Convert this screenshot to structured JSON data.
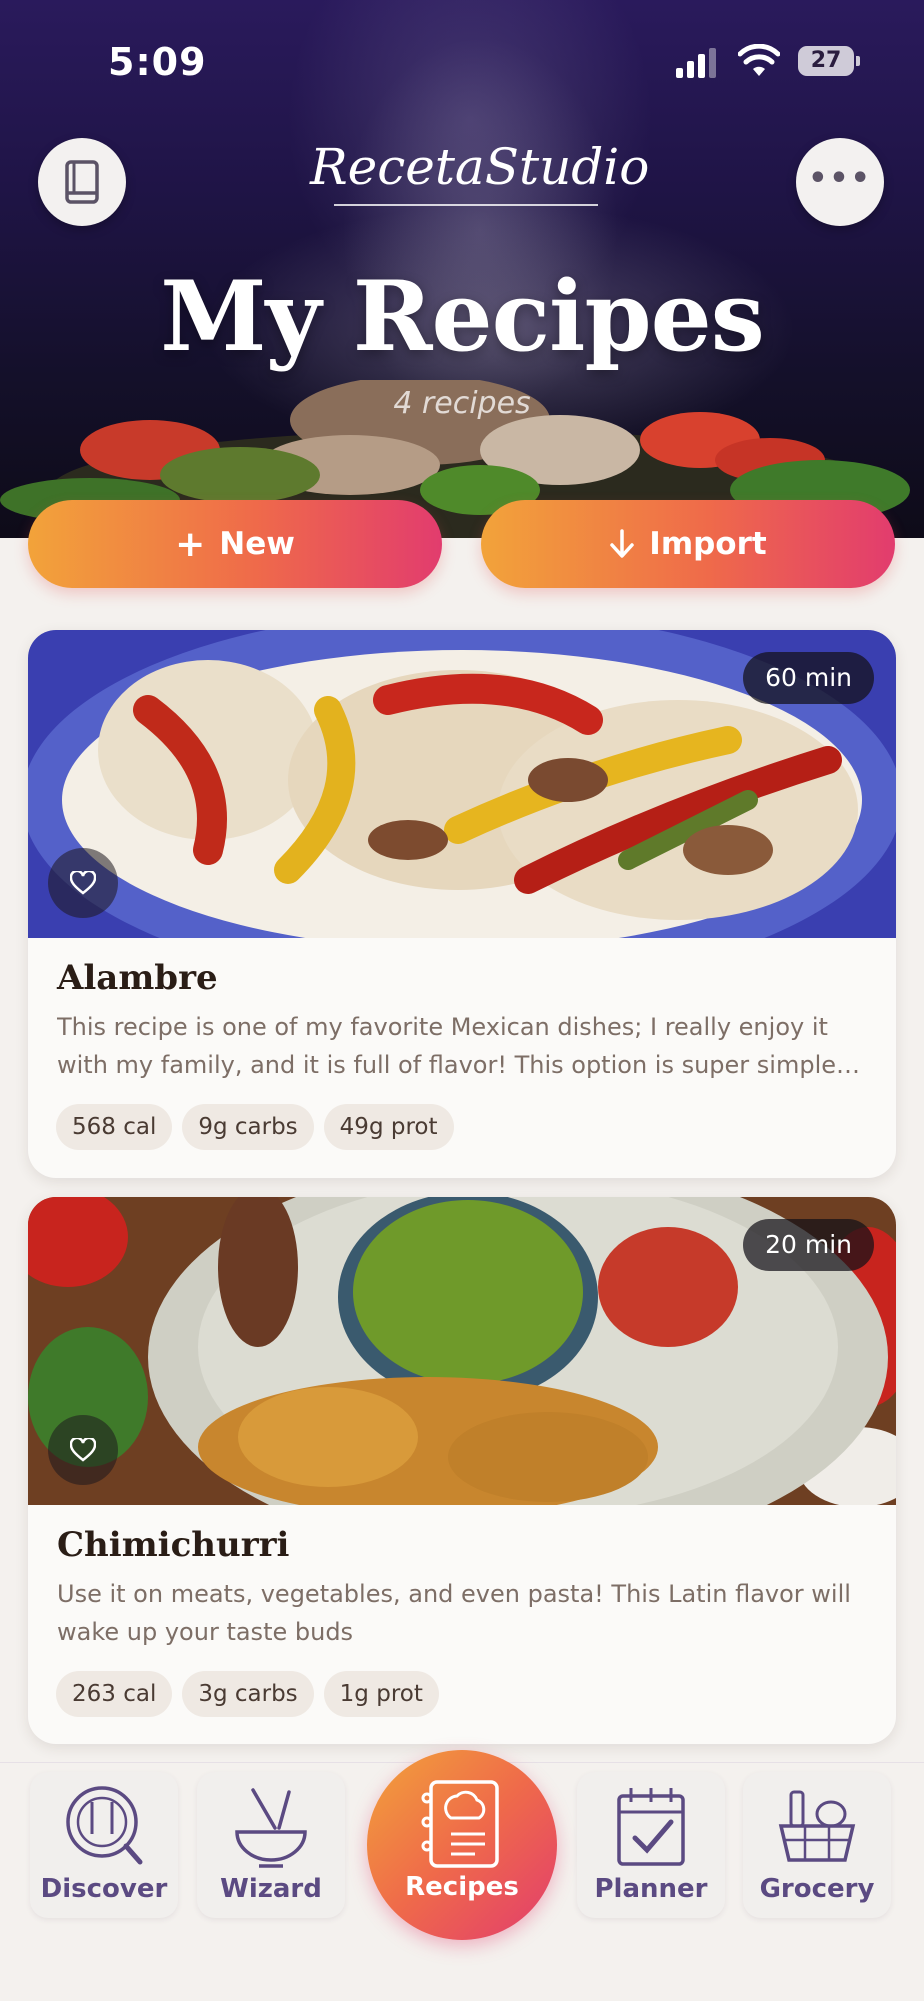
{
  "status_bar": {
    "time": "5:09",
    "battery": "27"
  },
  "header": {
    "logo": "RecetaStudio",
    "title": "My Recipes",
    "subtitle": "4 recipes"
  },
  "actions": {
    "new_label": "New",
    "import_label": "Import"
  },
  "recipes": [
    {
      "title": "Alambre",
      "time": "60 min",
      "description": "This recipe is one of my favorite Mexican dishes; I really enjoy it with my family, and it is full of flavor! This option is super simple, and you don’t…",
      "chips": [
        "568 cal",
        "9g carbs",
        "49g prot"
      ]
    },
    {
      "title": "Chimichurri",
      "time": "20 min",
      "description": "Use it on meats, vegetables, and even pasta! This Latin flavor will wake up your taste buds",
      "chips": [
        "263 cal",
        "3g carbs",
        "1g prot"
      ]
    }
  ],
  "bottom_nav": {
    "discover": "Discover",
    "wizard": "Wizard",
    "recipes": "Recipes",
    "planner": "Planner",
    "grocery": "Grocery"
  },
  "colors": {
    "accent_start": "#f2a33a",
    "accent_end": "#e23c6e",
    "nav_text": "#5b4a82",
    "hero_dark": "#1f1446"
  }
}
